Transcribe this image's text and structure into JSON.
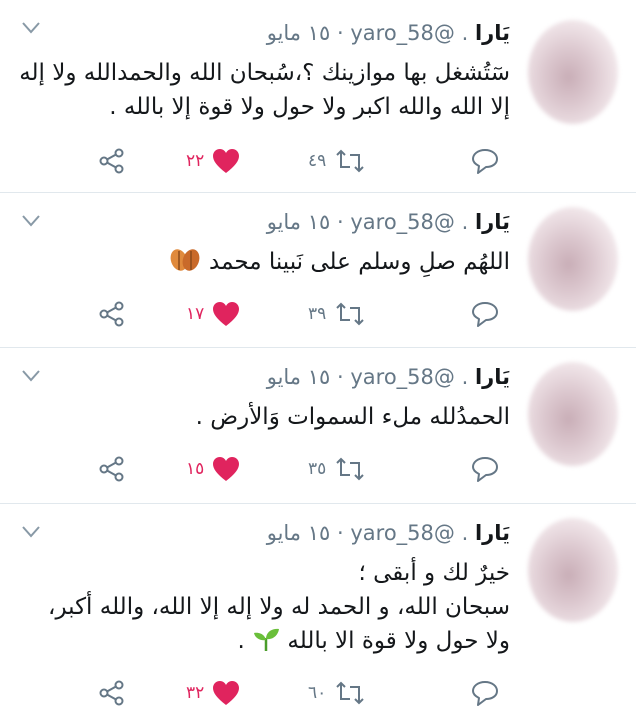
{
  "tweets": [
    {
      "name": "يَارا",
      "handle": "@yaro_58",
      "date": "١٥ مايو",
      "body_lines": [
        "سٓتُشغل بها موازينك ؟،سُبحان الله والحمدالله ولا إله",
        "إلا الله والله اكبر ولا حول ولا قوة إلا بالله ."
      ],
      "emoji": "",
      "retweets": "٤٩",
      "likes": "٢٢"
    },
    {
      "name": "يَارا",
      "handle": "@yaro_58",
      "date": "١٥ مايو",
      "body_lines": [
        "اللهُم صلِ وسلم على نَبينا محمد"
      ],
      "emoji": "leaves-emoji",
      "retweets": "٣٩",
      "likes": "١٧"
    },
    {
      "name": "يَارا",
      "handle": "@yaro_58",
      "date": "١٥ مايو",
      "body_lines": [
        "الحمدُلله ملء السموات وَالأرض ."
      ],
      "emoji": "",
      "retweets": "٣٥",
      "likes": "١٥"
    },
    {
      "name": "يَارا",
      "handle": "@yaro_58",
      "date": "١٥ مايو",
      "body_lines": [
        "خيرٌ لك و أبقى ؛",
        "سبحان الله، و الحمد له ولا إله إلا الله، والله أكبر،",
        "ولا حول ولا قوة الا بالله"
      ],
      "emoji": "seedling-emoji",
      "retweets": "٦٠",
      "likes": "٣٢"
    }
  ],
  "colors": {
    "like": "#e0245e",
    "muted": "#657786",
    "text": "#14171a",
    "divider": "#e1e8ed"
  }
}
